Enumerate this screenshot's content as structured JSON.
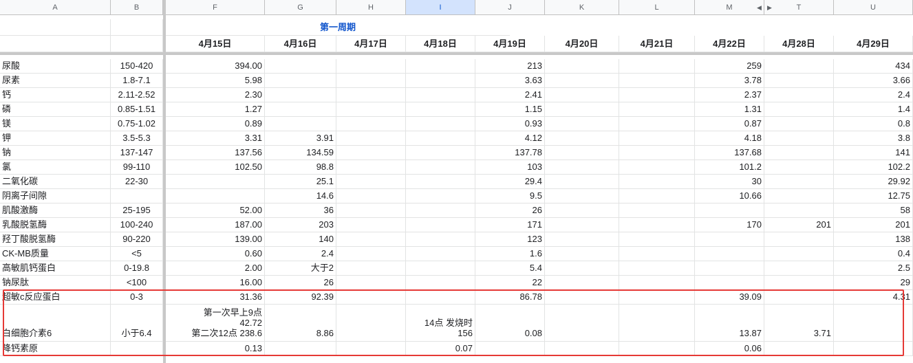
{
  "columns": [
    {
      "key": "A",
      "label": "A"
    },
    {
      "key": "B",
      "label": "B"
    },
    {
      "key": "F",
      "label": "F"
    },
    {
      "key": "G",
      "label": "G"
    },
    {
      "key": "H",
      "label": "H"
    },
    {
      "key": "I",
      "label": "I",
      "selected": true
    },
    {
      "key": "J",
      "label": "J"
    },
    {
      "key": "K",
      "label": "K"
    },
    {
      "key": "L",
      "label": "L"
    },
    {
      "key": "M",
      "label": "M"
    },
    {
      "key": "T",
      "label": "T"
    },
    {
      "key": "U",
      "label": "U"
    }
  ],
  "hidden_columns_indicator": {
    "left_arrow": "◀",
    "right_arrow": "▶"
  },
  "week_label": "第一周期",
  "dates": [
    "4月15日",
    "4月16日",
    "4月17日",
    "4月18日",
    "4月19日",
    "4月20日",
    "4月21日",
    "4月22日",
    "4月28日",
    "4月29日"
  ],
  "rows": [
    {
      "name": "尿酸",
      "range": "150-420",
      "F": "394.00",
      "G": "",
      "H": "",
      "I": "",
      "J": "213",
      "K": "",
      "L": "",
      "M": "259",
      "T": "",
      "U": "434"
    },
    {
      "name": "尿素",
      "range": "1.8-7.1",
      "F": "5.98",
      "G": "",
      "H": "",
      "I": "",
      "J": "3.63",
      "K": "",
      "L": "",
      "M": "3.78",
      "T": "",
      "U": "3.66"
    },
    {
      "name": "钙",
      "range": "2.11-2.52",
      "F": "2.30",
      "G": "",
      "H": "",
      "I": "",
      "J": "2.41",
      "K": "",
      "L": "",
      "M": "2.37",
      "T": "",
      "U": "2.4"
    },
    {
      "name": "磷",
      "range": "0.85-1.51",
      "F": "1.27",
      "G": "",
      "H": "",
      "I": "",
      "J": "1.15",
      "K": "",
      "L": "",
      "M": "1.31",
      "T": "",
      "U": "1.4"
    },
    {
      "name": "镁",
      "range": "0.75-1.02",
      "F": "0.89",
      "G": "",
      "H": "",
      "I": "",
      "J": "0.93",
      "K": "",
      "L": "",
      "M": "0.87",
      "T": "",
      "U": "0.8"
    },
    {
      "name": "钾",
      "range": "3.5-5.3",
      "F": "3.31",
      "G": "3.91",
      "H": "",
      "I": "",
      "J": "4.12",
      "K": "",
      "L": "",
      "M": "4.18",
      "T": "",
      "U": "3.8"
    },
    {
      "name": "钠",
      "range": "137-147",
      "F": "137.56",
      "G": "134.59",
      "H": "",
      "I": "",
      "J": "137.78",
      "K": "",
      "L": "",
      "M": "137.68",
      "T": "",
      "U": "141"
    },
    {
      "name": "氯",
      "range": "99-110",
      "F": "102.50",
      "G": "98.8",
      "H": "",
      "I": "",
      "J": "103",
      "K": "",
      "L": "",
      "M": "101.2",
      "T": "",
      "U": "102.2"
    },
    {
      "name": "二氧化碳",
      "range": "22-30",
      "F": "",
      "G": "25.1",
      "H": "",
      "I": "",
      "J": "29.4",
      "K": "",
      "L": "",
      "M": "30",
      "T": "",
      "U": "29.92"
    },
    {
      "name": "阴离子间隙",
      "range": "",
      "F": "",
      "G": "14.6",
      "H": "",
      "I": "",
      "J": "9.5",
      "K": "",
      "L": "",
      "M": "10.66",
      "T": "",
      "U": "12.75"
    },
    {
      "name": "肌酸激酶",
      "range": "25-195",
      "F": "52.00",
      "G": "36",
      "H": "",
      "I": "",
      "J": "26",
      "K": "",
      "L": "",
      "M": "",
      "T": "",
      "U": "58"
    },
    {
      "name": "乳酸脱氢酶",
      "range": "100-240",
      "F": "187.00",
      "G": "203",
      "H": "",
      "I": "",
      "J": "171",
      "K": "",
      "L": "",
      "M": "170",
      "T": "201",
      "U": "201"
    },
    {
      "name": "羟丁酸脱氢酶",
      "range": "90-220",
      "F": "139.00",
      "G": "140",
      "H": "",
      "I": "",
      "J": "123",
      "K": "",
      "L": "",
      "M": "",
      "T": "",
      "U": "138"
    },
    {
      "name": "CK-MB质量",
      "range": "<5",
      "F": "0.60",
      "G": "2.4",
      "H": "",
      "I": "",
      "J": "1.6",
      "K": "",
      "L": "",
      "M": "",
      "T": "",
      "U": "0.4"
    },
    {
      "name": "高敏肌钙蛋白",
      "range": "0-19.8",
      "F": "2.00",
      "G": "大于2",
      "H": "",
      "I": "",
      "J": "5.4",
      "K": "",
      "L": "",
      "M": "",
      "T": "",
      "U": "2.5"
    },
    {
      "name": "钠尿肽",
      "range": "<100",
      "F": "16.00",
      "G": "26",
      "H": "",
      "I": "",
      "J": "22",
      "K": "",
      "L": "",
      "M": "",
      "T": "",
      "U": "29"
    },
    {
      "name": "超敏c反应蛋白",
      "range": "0-3",
      "F": "31.36",
      "G": "92.39",
      "H": "",
      "I": "",
      "J": "86.78",
      "K": "",
      "L": "",
      "M": "39.09",
      "T": "",
      "U": "4.31"
    }
  ],
  "il6_row": {
    "name": "白细胞介素6",
    "range": "小于6.4",
    "F_lines": [
      "第一次早上9点",
      "42.72",
      "第二次12点 238.6"
    ],
    "G": "8.86",
    "I_lines": [
      "14点 发烧时",
      "156"
    ],
    "J": "0.08",
    "M": "13.87",
    "T": "3.71"
  },
  "pct_row": {
    "name": "降钙素原",
    "range": "",
    "F": "0.13",
    "I": "0.07",
    "M": "0.06"
  },
  "highlight_color": "#e53935",
  "week_color": "#1155cc"
}
